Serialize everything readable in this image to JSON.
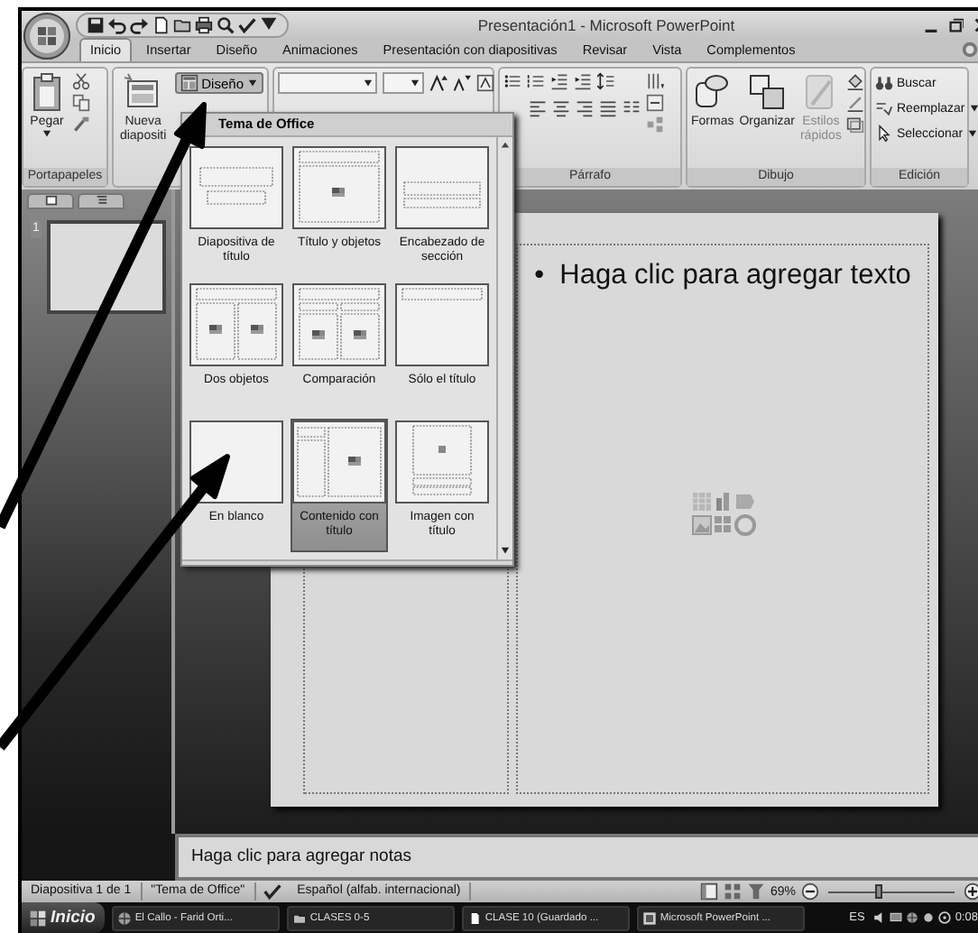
{
  "window": {
    "title": "Presentación1 - Microsoft PowerPoint"
  },
  "tabs": [
    {
      "label": "Inicio",
      "selected": true
    },
    {
      "label": "Insertar",
      "selected": false
    },
    {
      "label": "Diseño",
      "selected": false
    },
    {
      "label": "Animaciones",
      "selected": false
    },
    {
      "label": "Presentación con diapositivas",
      "selected": false
    },
    {
      "label": "Revisar",
      "selected": false
    },
    {
      "label": "Vista",
      "selected": false
    },
    {
      "label": "Complementos",
      "selected": false
    }
  ],
  "ribbon": {
    "clipboard": {
      "label": "Portapapeles",
      "paste": "Pegar"
    },
    "slides": {
      "new_slide": "Nueva diapositi",
      "layout": "Diseño"
    },
    "paragraph": {
      "label": "Párrafo"
    },
    "drawing": {
      "label": "Dibujo",
      "buttons": [
        {
          "label": "Formas",
          "disabled": false
        },
        {
          "label": "Organizar",
          "disabled": false
        },
        {
          "label": "Estilos rápidos",
          "disabled": true
        }
      ]
    },
    "editing": {
      "label": "Edición",
      "buttons": [
        {
          "label": "Buscar",
          "menu": false
        },
        {
          "label": "Reemplazar",
          "menu": true
        },
        {
          "label": "Seleccionar",
          "menu": true
        }
      ]
    }
  },
  "layout_menu": {
    "header": "Tema de Office",
    "layouts": [
      {
        "label": "Diapositiva de título",
        "kind": "title",
        "selected": false
      },
      {
        "label": "Título y objetos",
        "kind": "title-content",
        "selected": false
      },
      {
        "label": "Encabezado de sección",
        "kind": "section",
        "selected": false
      },
      {
        "label": "Dos objetos",
        "kind": "two-content",
        "selected": false
      },
      {
        "label": "Comparación",
        "kind": "comparison",
        "selected": false
      },
      {
        "label": "Sólo el título",
        "kind": "title-only",
        "selected": false
      },
      {
        "label": "En blanco",
        "kind": "blank",
        "selected": false
      },
      {
        "label": "Contenido con título",
        "kind": "content-caption",
        "selected": true
      },
      {
        "label": "Imagen con título",
        "kind": "picture-caption",
        "selected": false
      }
    ]
  },
  "slide_pane": {
    "slides": [
      {
        "number": "1"
      }
    ]
  },
  "slide": {
    "bullet": "•",
    "content_placeholder": "Haga clic para agregar texto"
  },
  "notes": {
    "placeholder": "Haga clic para agregar notas"
  },
  "status_bar": {
    "items": [
      "Diapositiva 1 de 1",
      "\"Tema de Office\"",
      "Español (alfab. internacional)"
    ],
    "zoom": "69%",
    "zoom_slider": {
      "level": 0.4
    }
  },
  "taskbar": {
    "start": "Inicio",
    "tasks": [
      {
        "label": "El Callo - Farid Orti..."
      },
      {
        "label": "CLASES 0-5"
      },
      {
        "label": "CLASE 10 (Guardado ..."
      },
      {
        "label": "Microsoft PowerPoint ..."
      }
    ],
    "language": "ES",
    "clock": "0:08"
  }
}
